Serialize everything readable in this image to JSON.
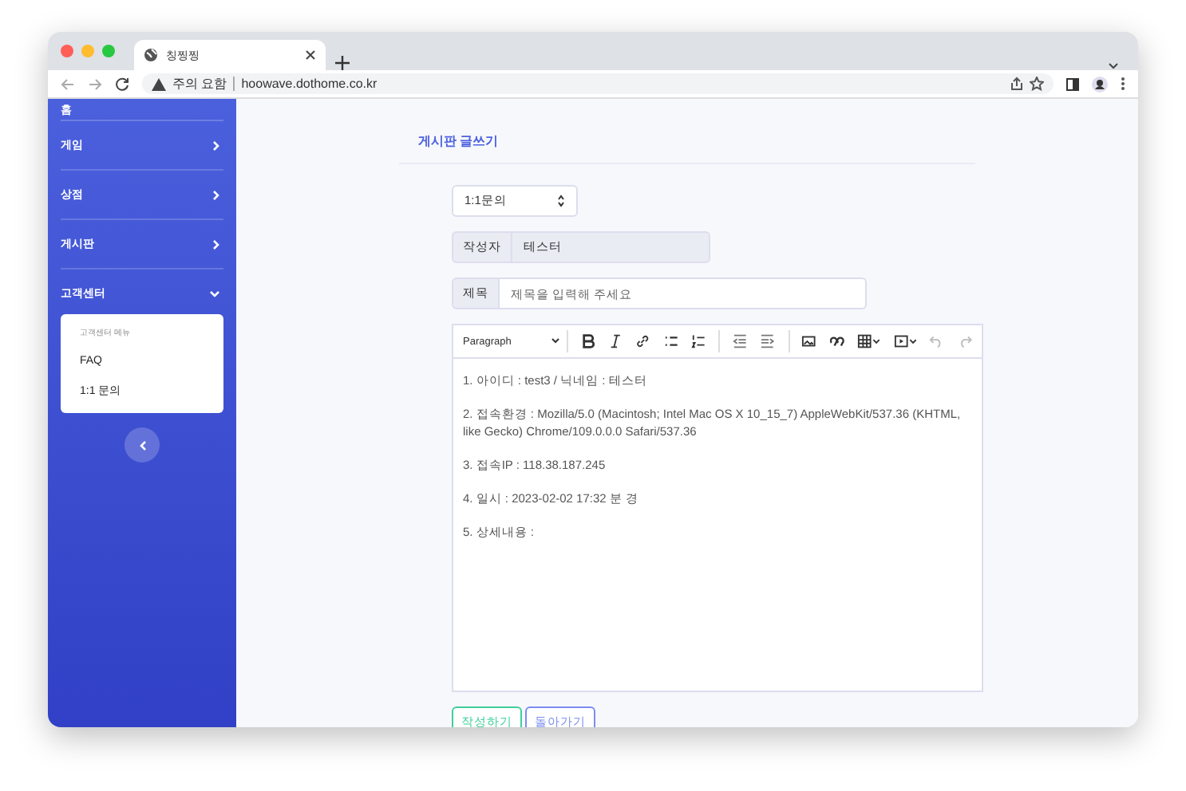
{
  "browser": {
    "tab_title": "칭찡찡",
    "security_label": "주의 요함",
    "url": "hoowave.dothome.co.kr"
  },
  "sidebar": {
    "home_label": "홈",
    "items": [
      {
        "label": "게임",
        "expanded": false
      },
      {
        "label": "상점",
        "expanded": false
      },
      {
        "label": "게시판",
        "expanded": false
      },
      {
        "label": "고객센터",
        "expanded": true,
        "submenu": {
          "header": "고객센터 메뉴",
          "items": [
            "FAQ",
            "1:1 문의"
          ]
        }
      }
    ]
  },
  "form": {
    "heading": "게시판 글쓰기",
    "category": "1:1문의",
    "author_label": "작성자",
    "author_value": "테스터",
    "title_label": "제목",
    "title_placeholder": "제목을 입력해 주세요",
    "editor": {
      "block_format": "Paragraph",
      "paragraphs": [
        "1. 아이디 : test3 / 닉네임 : 테스터",
        "2. 접속환경 : Mozilla/5.0 (Macintosh; Intel Mac OS X 10_15_7) AppleWebKit/537.36 (KHTML, like Gecko) Chrome/109.0.0.0 Safari/537.36",
        "3. 접속IP : 118.38.187.245",
        "4. 일시 : 2023-02-02 17:32 분 경",
        "5. 상세내용 :"
      ]
    },
    "buttons": [
      {
        "label": "작성하기",
        "color": "#3fcf9a"
      },
      {
        "label": "돌아가기",
        "color": "#7b8cf0"
      }
    ]
  }
}
